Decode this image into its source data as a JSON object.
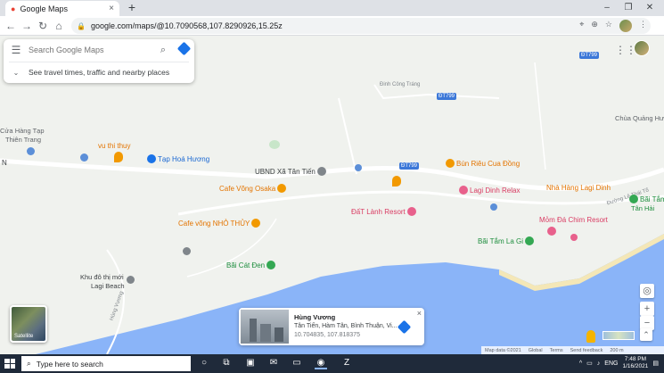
{
  "browser": {
    "tab_title": "Google Maps",
    "tab_close": "×",
    "new_tab": "+",
    "url": "google.com/maps/@10.7090568,107.8290926,15.25z",
    "window_controls": [
      "–",
      "❐",
      "✕"
    ]
  },
  "search": {
    "placeholder": "Search Google Maps",
    "directions_hint": "See travel times, traffic and nearby places"
  },
  "map": {
    "places": [
      {
        "label": "Cửa Hàng Tạp",
        "color": "#5f6368"
      },
      {
        "label": "Thiên Trang",
        "color": "#5f6368"
      },
      {
        "label": "vu thi thuy",
        "color": "#e37400"
      },
      {
        "label": "Tạp Hoá Hương",
        "color": "#1967d2"
      },
      {
        "label": "UBND Xã Tân Tiến",
        "color": "#5f6368"
      },
      {
        "label": "Cafe Võng Osaka",
        "color": "#e37400"
      },
      {
        "label": "Cafe võng NHỎ THỦY",
        "color": "#e37400"
      },
      {
        "label": "Bún Riêu Cua Đồng",
        "color": "#e37400"
      },
      {
        "label": "Lagi Dinh Relax",
        "color": "#d93c63"
      },
      {
        "label": "ĐấT Lành Resort",
        "color": "#d93c63"
      },
      {
        "label": "Chùa Quảng Hư",
        "color": "#5f6368"
      },
      {
        "label": "Nhà Hàng Lagi Dinh",
        "color": "#e37400"
      },
      {
        "label": "Bãi Tắm",
        "color": "#1e8e3e"
      },
      {
        "label": "Tân Hải",
        "color": "#1e8e3e"
      },
      {
        "label": "Mỏm Đá Chim Resort",
        "color": "#d93c63"
      },
      {
        "label": "Bãi Tắm La Gi",
        "color": "#1e8e3e"
      },
      {
        "label": "Bãi Cát Đen",
        "color": "#1e8e3e"
      },
      {
        "label": "Khu đô thị mới",
        "color": "#5f6368"
      },
      {
        "label": "Lagi Beach",
        "color": "#5f6368"
      }
    ],
    "roads": [
      "ĐT799",
      "ĐT799",
      "ĐT799",
      "Đinh Công Tráng",
      "Đường Lê Thái Tổ",
      "Hùng Vương",
      "N"
    ],
    "satellite_label": "Satellite"
  },
  "infocard": {
    "title": "Hùng Vương",
    "address": "Tân Tiến, Hàm Tân, Bình Thuận, Vi...",
    "coords": "10.704835, 107.818375",
    "close": "×"
  },
  "map_controls": {
    "zoom_in": "+",
    "zoom_out": "−",
    "status": [
      "Map data ©2021",
      "Global",
      "Terms",
      "Send feedback",
      "200 m"
    ]
  },
  "taskbar": {
    "search_placeholder": "Type here to search",
    "language": "ENG",
    "time": "7:48 PM",
    "date": "1/16/2021"
  }
}
